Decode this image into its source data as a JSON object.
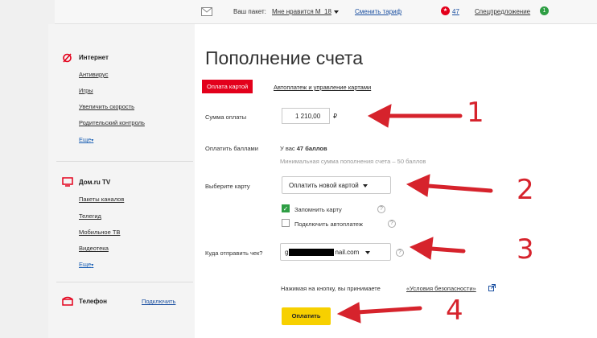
{
  "topbar": {
    "package_label": "Ваш пакет:",
    "package_value": "Мне нравится М_18",
    "change_tariff": "Сменить тариф",
    "notifications_count": "47",
    "special_offers": "Спецпредложение",
    "special_offers_badge": "1"
  },
  "sidebar": {
    "sections": [
      {
        "title": "Интернет",
        "items": [
          "Антивирус",
          "Игры",
          "Увеличить скорость",
          "Родительский контроль"
        ],
        "more": "Еще"
      },
      {
        "title": "Дом.ru TV",
        "items": [
          "Пакеты каналов",
          "Телегид",
          "Мобильное ТВ",
          "Видеотека"
        ],
        "more": "Еще"
      },
      {
        "title": "Телефон",
        "action": "Подключить"
      }
    ]
  },
  "main": {
    "title": "Пополнение счета",
    "tab_active": "Оплата картой",
    "tab_link": "Автоплатеж и управление картами",
    "amount_label": "Сумма оплаты",
    "amount_value": "1 210,00",
    "currency": "₽",
    "points_label": "Оплатить баллами",
    "points_text": "У вас",
    "points_value": "47 баллов",
    "points_min": "Минимальная сумма пополнения счета – 50 баллов",
    "card_label": "Выберите карту",
    "card_value": "Оплатить новой картой",
    "remember_card": "Запомнить карту",
    "autopay": "Подключить автоплатеж",
    "receipt_label": "Куда отправить чек?",
    "receipt_prefix": "g",
    "receipt_suffix": "nail.com",
    "agreement_text": "Нажимая на кнопку, вы принимаете",
    "agreement_link": "«Условия безопасности»",
    "pay_button": "Оплатить"
  },
  "annotations": [
    "1",
    "2",
    "3",
    "4"
  ],
  "colors": {
    "accent_red": "#e3001b",
    "arrow_red": "#d6232c",
    "pay_yellow": "#f7d000",
    "link_blue": "#1a4fa0",
    "check_green": "#2e9e44"
  }
}
